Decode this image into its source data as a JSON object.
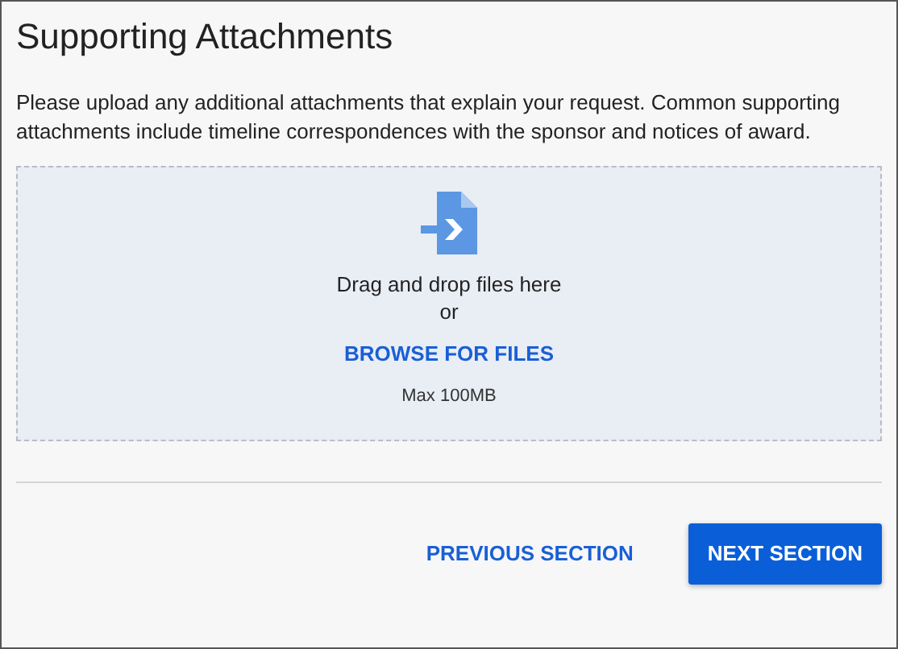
{
  "title": "Supporting Attachments",
  "description": "Please upload any additional attachments that explain your request. Common supporting attachments include timeline correspondences with the sponsor and notices of award.",
  "dropzone": {
    "prompt": "Drag and drop files here",
    "separator": "or",
    "browse": "BROWSE FOR FILES",
    "limit": "Max 100MB"
  },
  "buttons": [
    {
      "label": "PREVIOUS SECTION",
      "kind": "link"
    },
    {
      "label": "NEXT SECTION",
      "kind": "primary"
    }
  ]
}
